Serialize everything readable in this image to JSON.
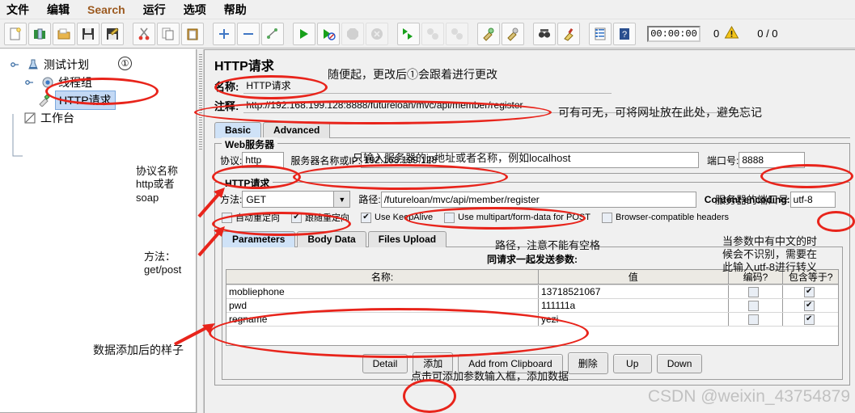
{
  "menu": {
    "items": [
      {
        "label": "文件",
        "accent": false
      },
      {
        "label": "编辑",
        "accent": false
      },
      {
        "label": "Search",
        "accent": true
      },
      {
        "label": "运行",
        "accent": false
      },
      {
        "label": "选项",
        "accent": false
      },
      {
        "label": "帮助",
        "accent": false
      }
    ]
  },
  "toolbar": {
    "buttons": [
      {
        "name": "new-icon",
        "glyph": "🗋"
      },
      {
        "name": "templates-icon",
        "glyph": "📚"
      },
      {
        "name": "open-icon",
        "glyph": "📂"
      },
      {
        "name": "save-icon",
        "glyph": "💾"
      },
      {
        "name": "save-as-icon",
        "glyph": "📝"
      },
      {
        "name": "cut-icon",
        "glyph": "✂"
      },
      {
        "name": "copy-icon",
        "glyph": "🗐"
      },
      {
        "name": "paste-icon",
        "glyph": "📋"
      },
      {
        "name": "expand-icon",
        "glyph": "✛"
      },
      {
        "name": "collapse-icon",
        "glyph": "━"
      },
      {
        "name": "toggle-icon",
        "glyph": "🖇"
      },
      {
        "name": "start-icon",
        "glyph": "▶"
      },
      {
        "name": "start-no-pause-icon",
        "glyph": "▶"
      },
      {
        "name": "stop-icon",
        "glyph": "🛑"
      },
      {
        "name": "shutdown-icon",
        "glyph": "✖"
      },
      {
        "name": "remote-start-icon",
        "glyph": "▶"
      },
      {
        "name": "remote-stop-icon",
        "glyph": "◍"
      },
      {
        "name": "remote-shutdown-icon",
        "glyph": "◍"
      },
      {
        "name": "clear-icon",
        "glyph": "🧹"
      },
      {
        "name": "clear-all-icon",
        "glyph": "🧹"
      },
      {
        "name": "search-icon",
        "glyph": "🔭"
      },
      {
        "name": "reset-search-icon",
        "glyph": "🧹"
      },
      {
        "name": "function-helper-icon",
        "glyph": "📘"
      },
      {
        "name": "help-icon",
        "glyph": "❓"
      }
    ],
    "timer": "00:00:00",
    "warning_count": "0",
    "warning_icon": "warning-triangle-icon",
    "threads": "0 / 0"
  },
  "tree": {
    "nodes": [
      {
        "label": "测试计划",
        "icon": "test-plan-icon",
        "selected": false,
        "level": 0
      },
      {
        "label": "线程组",
        "icon": "thread-group-icon",
        "selected": false,
        "level": 1
      },
      {
        "label": "HTTP请求",
        "icon": "http-sampler-icon",
        "selected": true,
        "level": 2
      },
      {
        "label": "工作台",
        "icon": "workbench-icon",
        "selected": false,
        "level": 0
      }
    ]
  },
  "panel": {
    "title": "HTTP请求",
    "name_label": "名称:",
    "name_value": "HTTP请求",
    "comment_label": "注释:",
    "comment_value": "http://192.168.199.128:8888/futureloan/mvc/api/member/register",
    "tabs": [
      {
        "label": "Basic",
        "active": true
      },
      {
        "label": "Advanced",
        "active": false
      }
    ],
    "webserver": {
      "title": "Web服务器",
      "protocol_label": "协议:",
      "protocol_value": "http",
      "host_label": "服务器名称或IP:",
      "host_value": "192.168.199.128",
      "port_label": "端口号:",
      "port_value": "8888"
    },
    "httprequest": {
      "title": "HTTP请求",
      "method_label": "方法:",
      "method_value": "GET",
      "path_label": "路径:",
      "path_value": "/futureloan/mvc/api/member/register",
      "encoding_label": "Content encoding:",
      "encoding_value": "utf-8"
    },
    "checkboxes": [
      {
        "label": "自动重定向",
        "checked": false
      },
      {
        "label": "跟随重定向",
        "checked": true
      },
      {
        "label": "Use KeepAlive",
        "checked": true
      },
      {
        "label": "Use multipart/form-data for POST",
        "checked": false
      },
      {
        "label": "Browser-compatible headers",
        "checked": false
      }
    ],
    "param_tabs": [
      {
        "label": "Parameters",
        "active": true
      },
      {
        "label": "Body Data",
        "active": false
      },
      {
        "label": "Files Upload",
        "active": false
      }
    ],
    "params_caption": "同请求一起发送参数:",
    "table": {
      "headers": [
        "名称:",
        "值",
        "编码?",
        "包含等于?"
      ],
      "rows": [
        {
          "name": "mobliephone",
          "value": "13718521067",
          "encode": false,
          "include_equals": true
        },
        {
          "name": "pwd",
          "value": "111111a",
          "encode": false,
          "include_equals": true
        },
        {
          "name": "regname",
          "value": "yezi",
          "encode": false,
          "include_equals": true
        }
      ]
    },
    "buttons": [
      {
        "label": "Detail",
        "name": "detail-button"
      },
      {
        "label": "添加",
        "name": "add-button"
      },
      {
        "label": "Add from Clipboard",
        "name": "add-from-clipboard-button"
      },
      {
        "label": "删除",
        "name": "delete-button"
      },
      {
        "label": "Up",
        "name": "up-button"
      },
      {
        "label": "Down",
        "name": "down-button"
      }
    ]
  },
  "annotations": {
    "circle_one": "①",
    "name_note": "随便起，更改后①会跟着进行更改",
    "comment_note": "可有可无，可将网址放在此处，避免忘记",
    "host_note": "只输入服务器的ip地址或者名称，例如localhost",
    "port_note": "服务器的端口号",
    "protocol_note": "协议名称\nhttp或者\nsoap",
    "method_note": "方法：\nget/post",
    "path_note": "路径，注意不能有空格",
    "encoding_note": "当参数中有中文的时\n候会不识别，需要在\n此输入utf-8进行转义",
    "table_note": "数据添加后的样子",
    "add_note": "点击可添加参数输入框，添加数据",
    "watermark": "CSDN @weixin_43754879"
  },
  "colors": {
    "annotation_red": "#e8241b",
    "accent_menu": "#9c5a20",
    "selection_blue": "#c3d9f5",
    "tab_active": "#cfe2f7"
  }
}
